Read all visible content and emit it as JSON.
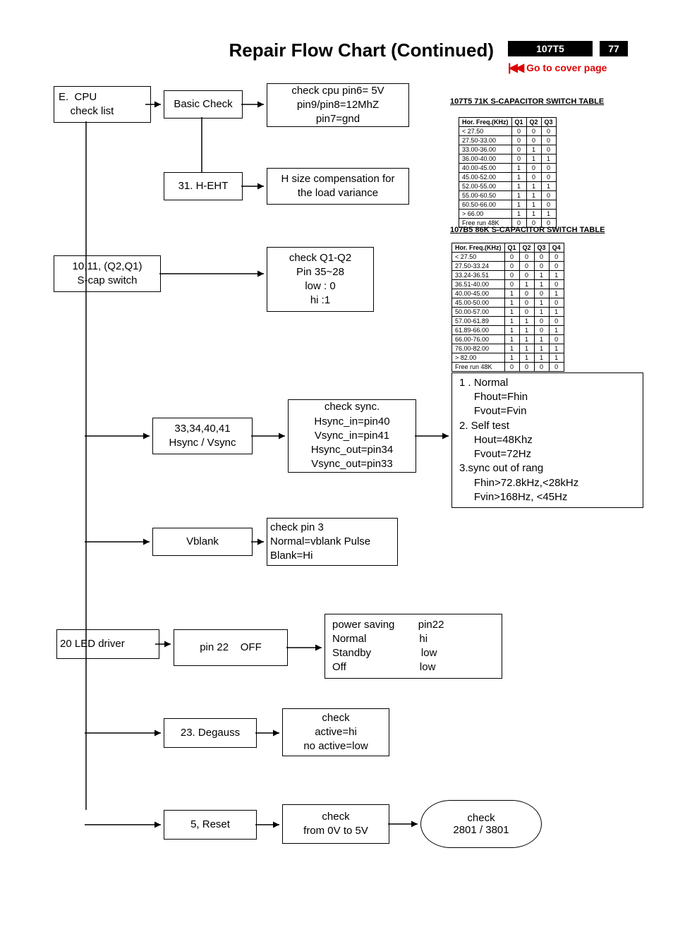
{
  "header": {
    "title": "Repair Flow Chart (Continued)",
    "model": "107T5",
    "page": "77",
    "cover": "Go to cover page"
  },
  "boxes": {
    "eCpu": "E.  CPU\n    check list",
    "basic": "Basic Check",
    "cpuPins": "check cpu pin6= 5V\npin9/pin8=12MhZ\npin7=gnd",
    "heht": "31. H-EHT",
    "hsize": "H size compensation for\nthe load variance",
    "scap": "10,11, (Q2,Q1)\nS-cap switch",
    "q1q2": "check Q1-Q2\nPin 35~28\nlow : 0\nhi :1",
    "hsync": "33,34,40,41\nHsync / Vsync",
    "syncChk": "check sync.\nHsync_in=pin40\nVsync_in=pin41\nHsync_out=pin34\nVsync_out=pin33",
    "syncStates": "1 . Normal\n     Fhout=Fhin\n     Fvout=Fvin\n2. Self test\n     Hout=48Khz\n     Fvout=72Hz\n3.sync out of rang\n     Fhin>72.8kHz,<28kHz\n     Fvin>168Hz, <45Hz",
    "vblank": "Vblank",
    "vblankChk": "check pin 3\nNormal=vblank Pulse\nBlank=Hi",
    "led": "20 LED driver",
    "pin22": "pin 22    OFF",
    "psav": "power saving        pin22\nNormal                  hi\nStandby                 low\nOff                         low",
    "degauss": "23. Degauss",
    "degaussChk": "check\nactive=hi\nno active=low",
    "reset": "5, Reset",
    "resetChk": "check\nfrom 0V to 5V",
    "term": "check\n2801 / 3801"
  },
  "tables": {
    "t71": {
      "title": "107T5 71K S-CAPACITOR SWITCH TABLE",
      "head": [
        "Hor. Freq.(KHz)",
        "Q1",
        "Q2",
        "Q3"
      ],
      "rows": [
        [
          "< 27.50",
          "0",
          "0",
          "0"
        ],
        [
          "27.50-33.00",
          "0",
          "0",
          "0"
        ],
        [
          "33.00-36.00",
          "0",
          "1",
          "0"
        ],
        [
          "36.00-40.00",
          "0",
          "1",
          "1"
        ],
        [
          "40.00-45.00",
          "1",
          "0",
          "0"
        ],
        [
          "45.00-52.00",
          "1",
          "0",
          "0"
        ],
        [
          "52.00-55.00",
          "1",
          "1",
          "1"
        ],
        [
          "55.00-60.50",
          "1",
          "1",
          "0"
        ],
        [
          "60.50-66.00",
          "1",
          "1",
          "0"
        ],
        [
          "> 66.00",
          "1",
          "1",
          "1"
        ],
        [
          "Free run 48K",
          "0",
          "0",
          "0"
        ]
      ]
    },
    "t86": {
      "title": "107B5 86K S-CAPACITOR SWITCH TABLE",
      "head": [
        "Hor. Freq.(KHz)",
        "Q1",
        "Q2",
        "Q3",
        "Q4"
      ],
      "rows": [
        [
          "< 27.50",
          "0",
          "0",
          "0",
          "0"
        ],
        [
          "27.50-33.24",
          "0",
          "0",
          "0",
          "0"
        ],
        [
          "33.24-36.51",
          "0",
          "0",
          "1",
          "1"
        ],
        [
          "36.51-40.00",
          "0",
          "1",
          "1",
          "0"
        ],
        [
          "40.00-45.00",
          "1",
          "0",
          "0",
          "1"
        ],
        [
          "45.00-50.00",
          "1",
          "0",
          "1",
          "0"
        ],
        [
          "50.00-57.00",
          "1",
          "0",
          "1",
          "1"
        ],
        [
          "57.00-61.89",
          "1",
          "1",
          "0",
          "0"
        ],
        [
          "61.89-66.00",
          "1",
          "1",
          "0",
          "1"
        ],
        [
          "66.00-76.00",
          "1",
          "1",
          "1",
          "0"
        ],
        [
          "76.00-82.00",
          "1",
          "1",
          "1",
          "1"
        ],
        [
          "> 82.00",
          "1",
          "1",
          "1",
          "1"
        ],
        [
          "Free run 48K",
          "0",
          "0",
          "0",
          "0"
        ]
      ]
    }
  }
}
